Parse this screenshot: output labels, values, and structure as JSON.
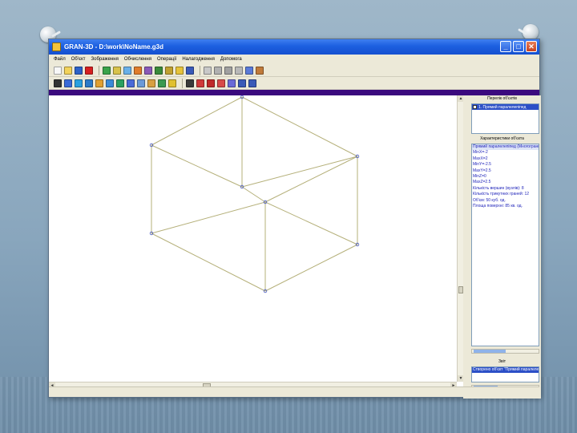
{
  "window": {
    "title": "GRAN-3D - D:\\work\\NoName.g3d",
    "controls": {
      "minimize": "_",
      "maximize": "□",
      "close": "✕"
    }
  },
  "menu": [
    "Файл",
    "Об'єкт",
    "Зображення",
    "Обчислення",
    "Операції",
    "Налагодження",
    "Допомога"
  ],
  "right_panel": {
    "objects_caption": "Перелік об'єктів",
    "objects": [
      {
        "label": "1. Прямий паралелепіпед",
        "checked": true
      }
    ],
    "props_caption": "Характеристики об'єкта",
    "properties": [
      "Прямий паралелепіпед (Многогранник)",
      "MinX=-2",
      "MaxX=2",
      "MinY=-2.5",
      "MaxY=2.5",
      "MinZ=0",
      "MaxZ=2.5",
      "Кількість вершин (вузлів): 8",
      "Кількість трикутних граней: 12",
      "Об'єм: 50 куб. од.",
      "Площа поверхні: 85 кв. од."
    ],
    "log_caption": "Звіт",
    "log_entries": [
      "Створено об'єкт \"Прямий паралелепіпед\""
    ]
  },
  "colors": {
    "title_bar": "#1c5fe0",
    "accent_bar": "#3b0a7e",
    "wireframe_edge": "#b5b07a",
    "vertex_marker": "#4a5bc4",
    "selection": "#2c4fc7"
  },
  "icons": {
    "toolbar1": [
      "new-file-icon",
      "open-folder-icon",
      "save-icon",
      "stop-icon",
      "cube-green-icon",
      "cylinder-icon",
      "cone-icon",
      "sphere-icon",
      "torus-icon",
      "prism-icon",
      "pyramid-icon",
      "light-icon",
      "help-icon",
      "cursor-icon",
      "delete-icon",
      "cut-icon",
      "paste-icon",
      "question-icon",
      "grab-icon"
    ],
    "toolbar2": [
      "arrow-icon",
      "axes-icon",
      "rotate-icon",
      "color-icon",
      "paint-icon",
      "texture-icon",
      "move-icon",
      "scale-icon",
      "mirror-icon",
      "fill-icon",
      "palette-icon",
      "light-bulb-icon",
      "render-icon",
      "red-cube-icon",
      "red-cube-2-icon",
      "red-cube-3-icon",
      "zoom-fit-icon",
      "zoom-in-icon",
      "zoom-out-icon"
    ]
  }
}
